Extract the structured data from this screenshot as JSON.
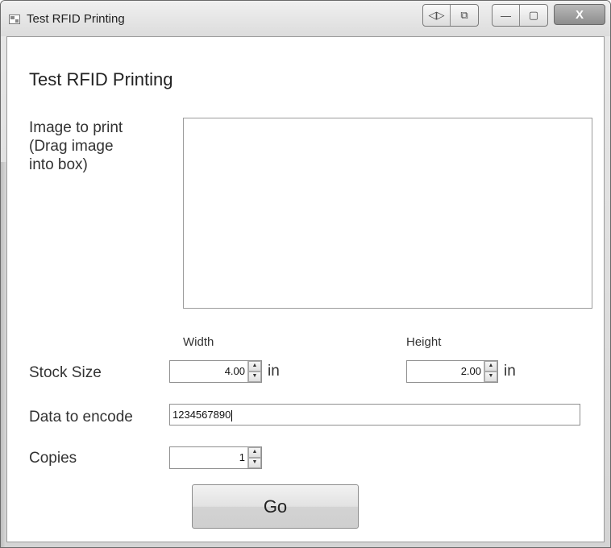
{
  "window": {
    "title": "Test RFID Printing"
  },
  "titlebar": {
    "extra_buttons": [
      "◁▷",
      "⧉"
    ],
    "minimize_glyph": "—",
    "maximize_glyph": "▢",
    "close_glyph": "X"
  },
  "form": {
    "heading": "Test RFID Printing",
    "image_label_line1": "Image to print",
    "image_label_line2": "(Drag image",
    "image_label_line3": "into box)",
    "width_label": "Width",
    "height_label": "Height",
    "stock_size_label": "Stock Size",
    "width_value": "4.00",
    "height_value": "2.00",
    "width_unit": "in",
    "height_unit": "in",
    "data_label": "Data to encode",
    "data_value": "1234567890",
    "copies_label": "Copies",
    "copies_value": "1",
    "go_label": "Go"
  },
  "icons": {
    "up_arrow": "▲",
    "down_arrow": "▼"
  }
}
